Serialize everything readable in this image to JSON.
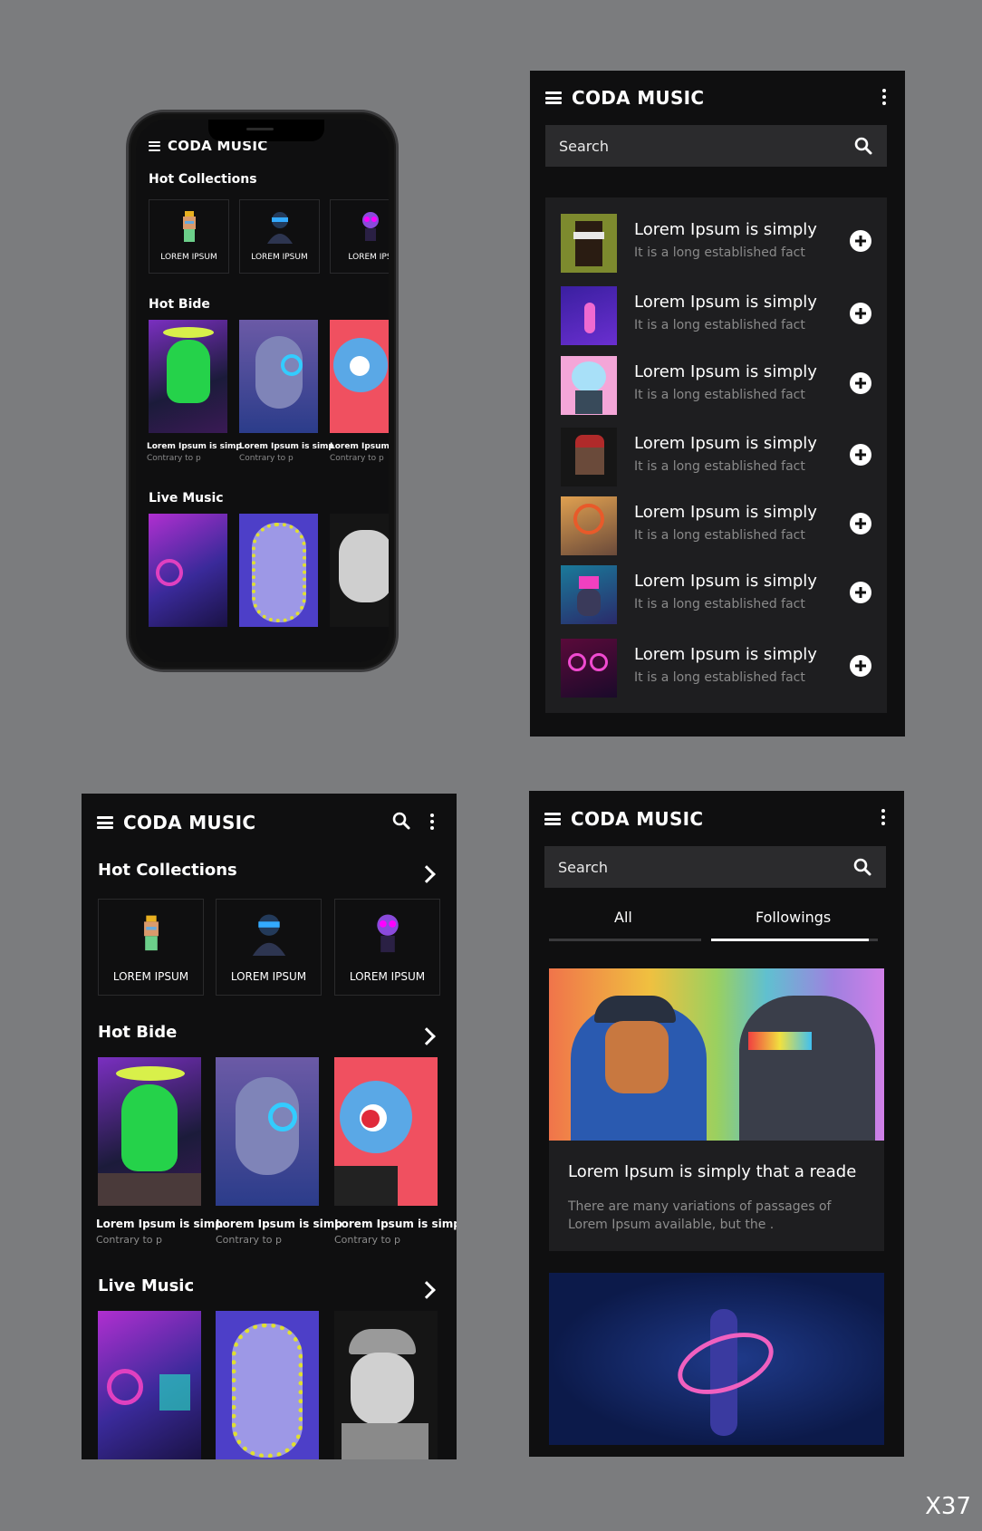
{
  "app": {
    "title": "CODA MUSIC"
  },
  "search": {
    "placeholder": "Search"
  },
  "sections": {
    "hot_collections": "Hot Collections",
    "hot_bide": "Hot Bide",
    "live_music": "Live Music"
  },
  "collections": [
    {
      "label": "LOREM IPSUM"
    },
    {
      "label": "LOREM IPSUM"
    },
    {
      "label": "LOREM IPSUM"
    }
  ],
  "phone_collection_labels": [
    "LOREM IPSUM",
    "LOREM IPSUM",
    "LOREM IPS"
  ],
  "hot_bide": [
    {
      "title": "Lorem Ipsum is simp",
      "sub": "Contrary to p"
    },
    {
      "title": "Lorem Ipsum is simp",
      "sub": "Contrary to p"
    },
    {
      "title": "Lorem Ipsum is simp",
      "sub": "Contrary to p"
    }
  ],
  "phone_hot_bide": [
    {
      "title": "Lorem Ipsum is simp",
      "sub": "Contrary to p"
    },
    {
      "title": "Lorem Ipsum is simp",
      "sub": "Contrary to p"
    },
    {
      "title": "Lorem Ipsum",
      "sub": "Contrary to p"
    }
  ],
  "list": [
    {
      "title": "Lorem Ipsum is simply",
      "sub": "It is a long established fact"
    },
    {
      "title": "Lorem Ipsum is simply",
      "sub": "It is a long established fact"
    },
    {
      "title": "Lorem Ipsum is simply",
      "sub": "It is a long established fact"
    },
    {
      "title": "Lorem Ipsum is simply",
      "sub": "It is a long established fact"
    },
    {
      "title": "Lorem Ipsum is simply",
      "sub": "It is a long established fact"
    },
    {
      "title": "Lorem Ipsum is simply",
      "sub": "It is a long established fact"
    },
    {
      "title": "Lorem Ipsum is simply",
      "sub": "It is a long established fact"
    }
  ],
  "tabs": {
    "all": "All",
    "followings": "Followings",
    "active": "Followings"
  },
  "feed": {
    "title": "Lorem Ipsum is simply that a reade",
    "desc": "There are many variations of passages of Lorem Ipsum available, but the ."
  },
  "watermark": "X37",
  "colors": {
    "background": "#7b7c7e",
    "panel": "#0f0f10",
    "card": "#1e1e20",
    "muted_text": "#8a8a8a"
  }
}
